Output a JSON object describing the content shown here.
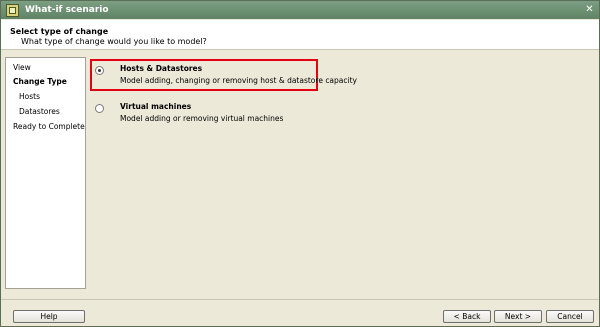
{
  "window": {
    "title": "What-if scenario",
    "icon": "vmware-window-icon"
  },
  "header": {
    "title": "Select type of change",
    "subtitle": "What type of change would you like to model?"
  },
  "nav": {
    "items": [
      {
        "label": "View",
        "active": false
      },
      {
        "label": "Change Type",
        "active": true
      },
      {
        "label": "Hosts",
        "active": false
      },
      {
        "label": "Datastores",
        "active": false
      },
      {
        "label": "Ready to Complete",
        "active": false
      }
    ]
  },
  "options": [
    {
      "title": "Hosts & Datastores",
      "description": "Model adding, changing or removing host & datastore capacity",
      "selected": true
    },
    {
      "title": "Virtual machines",
      "description": "Model adding or removing virtual machines",
      "selected": false
    }
  ],
  "buttons": {
    "help": "Help",
    "back": "< Back",
    "next": "Next >",
    "cancel": "Cancel"
  },
  "colors": {
    "highlight": "#e3000f",
    "titlebar": "#6b8f71"
  }
}
